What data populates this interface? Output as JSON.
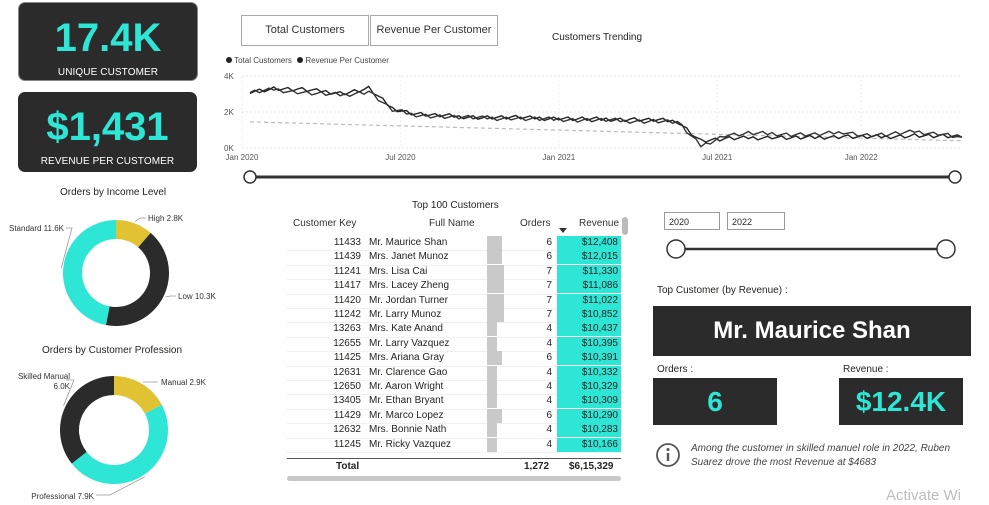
{
  "kpis": {
    "unique_customer_value": "17.4K",
    "unique_customer_caption": "UNIQUE CUSTOMER",
    "revenue_per_customer_value": "$1,431",
    "revenue_per_customer_caption": "REVENUE PER CUSTOMER"
  },
  "buttons": {
    "total_customers": "Total Customers",
    "revenue_per_customer": "Revenue Per Customer"
  },
  "trend_chart": {
    "chart_data": {
      "type": "line",
      "title": "Customers Trending",
      "legend": [
        "Total Customers",
        "Revenue Per Customer"
      ],
      "legend_placement": "top-left",
      "y_ticks": [
        "4K",
        "2K",
        "0K"
      ],
      "ylim": [
        0,
        4000
      ],
      "x_ticks": [
        "Jan 2020",
        "Jul 2020",
        "Jan 2021",
        "Jul 2021",
        "Jan 2022"
      ],
      "series": [
        {
          "name": "Total Customers",
          "approx_values": [
            3150,
            3300,
            3250,
            3150,
            3050,
            3300,
            2200,
            1900,
            1800,
            1750,
            1700,
            1700,
            1650,
            1650,
            1600,
            1600,
            1600,
            1550,
            1500,
            400,
            500,
            550,
            600,
            550,
            600,
            650,
            600,
            650,
            700,
            650,
            600
          ]
        },
        {
          "name": "Revenue Per Customer",
          "approx_values": [
            3050,
            3250,
            3100,
            3000,
            2950,
            3150,
            2100,
            1850,
            1750,
            1700,
            1650,
            1650,
            1600,
            1600,
            1550,
            1550,
            1500,
            1500,
            1450,
            100,
            700,
            800,
            800,
            750,
            750,
            900,
            700,
            750,
            900,
            800,
            600
          ]
        }
      ],
      "trend_line": [
        1450,
        400
      ]
    }
  },
  "income_chart": {
    "title": "Orders by Income Level",
    "chart_data": {
      "type": "pie",
      "labels": [
        "High",
        "Low",
        "Standard"
      ],
      "values": [
        2.8,
        10.3,
        11.6
      ],
      "value_labels": [
        "High 2.8K",
        "Low 10.3K",
        "Standard 11.6K"
      ],
      "colors": [
        "#e1c233",
        "#2b2b2b",
        "#2ee6d6"
      ]
    }
  },
  "profession_chart": {
    "title": "Orders by Customer Profession",
    "chart_data": {
      "type": "pie",
      "labels": [
        "Manual",
        "Professional",
        "Skilled Manual"
      ],
      "values": [
        2.9,
        7.9,
        6.0
      ],
      "value_labels": [
        "Manual 2.9K",
        "Professional 7.9K",
        "Skilled Manual 6.0K"
      ],
      "colors": [
        "#e1c233",
        "#2ee6d6",
        "#2b2b2b"
      ]
    }
  },
  "table": {
    "title": "Top 100 Customers",
    "headers": [
      "Customer Key",
      "Full Name",
      "Orders",
      "Revenue"
    ],
    "rows": [
      [
        "11433",
        "Mr. Maurice Shan",
        "6",
        "$12,408"
      ],
      [
        "11439",
        "Mrs. Janet Munoz",
        "6",
        "$12,015"
      ],
      [
        "11241",
        "Mrs. Lisa Cai",
        "7",
        "$11,330"
      ],
      [
        "11417",
        "Mrs. Lacey Zheng",
        "7",
        "$11,086"
      ],
      [
        "11420",
        "Mr. Jordan Turner",
        "7",
        "$11,022"
      ],
      [
        "11242",
        "Mr. Larry Munoz",
        "7",
        "$10,852"
      ],
      [
        "13263",
        "Mrs. Kate Anand",
        "4",
        "$10,437"
      ],
      [
        "12655",
        "Mr. Larry Vazquez",
        "4",
        "$10,395"
      ],
      [
        "11425",
        "Mrs. Ariana Gray",
        "6",
        "$10,391"
      ],
      [
        "12631",
        "Mr. Clarence Gao",
        "4",
        "$10,332"
      ],
      [
        "12650",
        "Mr. Aaron Wright",
        "4",
        "$10,329"
      ],
      [
        "13405",
        "Mr. Ethan Bryant",
        "4",
        "$10,309"
      ],
      [
        "11429",
        "Mr. Marco Lopez",
        "6",
        "$10,290"
      ],
      [
        "12632",
        "Mrs. Bonnie Nath",
        "4",
        "$10,283"
      ],
      [
        "11245",
        "Mr. Ricky Vazquez",
        "4",
        "$10,166"
      ]
    ],
    "total_label": "Total",
    "total_orders": "1,272",
    "total_revenue": "$6,15,329"
  },
  "slicer": {
    "from": "2020",
    "to": "2022",
    "low_fraction": 0,
    "high_fraction": 1
  },
  "top_customer": {
    "label": "Top Customer (by Revenue) :",
    "name": "Mr. Maurice Shan",
    "orders_label": "Orders :",
    "orders_value": "6",
    "revenue_label": "Revenue :",
    "revenue_value": "$12.4K"
  },
  "insight": {
    "icon": "info-icon",
    "text": "Among the customer in skilled manuel role in 2022, Ruben Suarez drove the most Revenue at $4683"
  },
  "watermark": "Activate Wi"
}
